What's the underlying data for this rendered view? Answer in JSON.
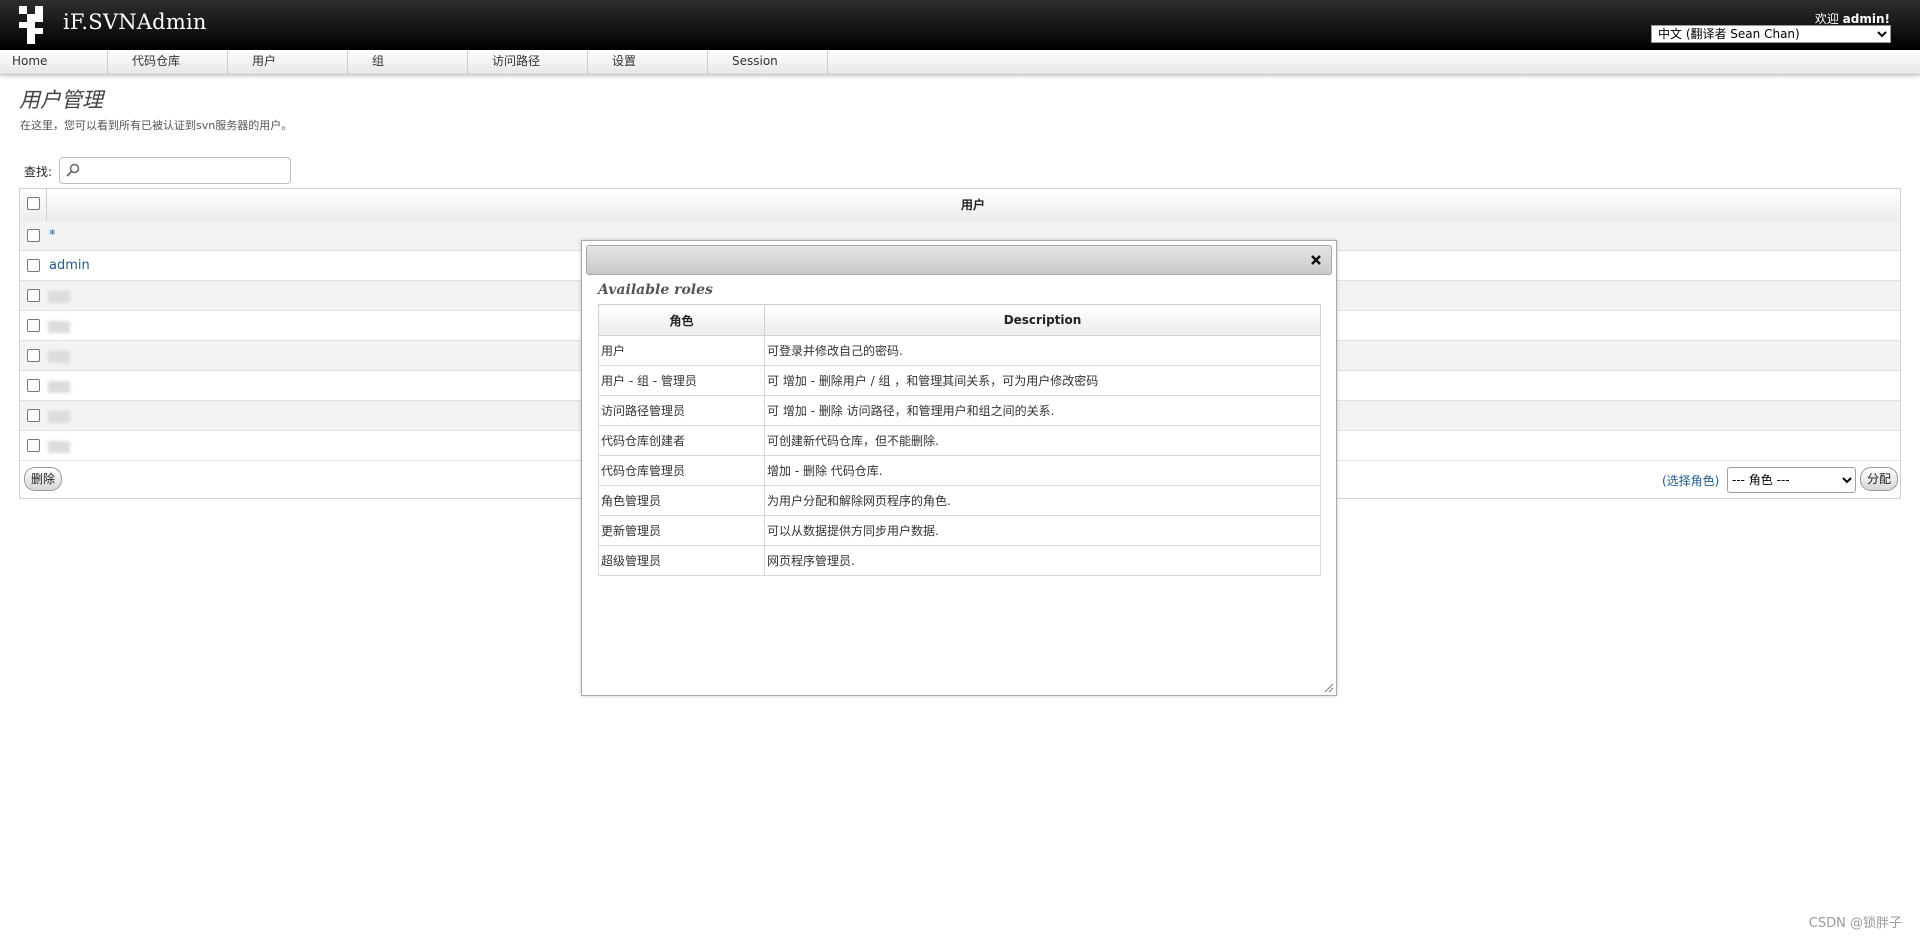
{
  "header": {
    "app_title": "iF.SVNAdmin",
    "welcome_prefix": "欢迎",
    "welcome_user": "admin!",
    "language": "中文 (翻译者 Sean Chan)"
  },
  "nav": {
    "items": [
      "Home",
      "代码仓库",
      "用户",
      "组",
      "访问路径",
      "设置",
      "Session"
    ]
  },
  "page": {
    "title": "用户管理",
    "description": "在这里，您可以看到所有已被认证到svn服务器的用户。"
  },
  "search": {
    "label": "查找:",
    "value": ""
  },
  "users_table": {
    "header": "用户",
    "rows": [
      "*",
      "admin",
      "",
      "",
      "",
      "",
      "",
      ""
    ],
    "delete_button": "删除",
    "select_role_link": "(选择角色)",
    "role_select_value": "--- 角色 ---",
    "assign_button": "分配"
  },
  "dialog": {
    "heading": "Available roles",
    "columns": [
      "角色",
      "Description"
    ],
    "roles": [
      {
        "name": "用户",
        "description": "可登录并修改自己的密码."
      },
      {
        "name": "用户 - 组 - 管理员",
        "description": "可 增加 - 删除用户 / 组 ，和管理其间关系，可为用户修改密码"
      },
      {
        "name": "访问路径管理员",
        "description": "可 增加 - 删除 访问路径，和管理用户和组之间的关系."
      },
      {
        "name": "代码仓库创建者",
        "description": "可创建新代码仓库，但不能删除."
      },
      {
        "name": "代码仓库管理员",
        "description": "增加 - 删除 代码仓库."
      },
      {
        "name": "角色管理员",
        "description": "为用户分配和解除网页程序的角色."
      },
      {
        "name": "更新管理员",
        "description": "可以从数据提供方同步用户数据."
      },
      {
        "name": "超级管理员",
        "description": "网页程序管理员."
      }
    ]
  },
  "watermark": "CSDN @锁胖子"
}
